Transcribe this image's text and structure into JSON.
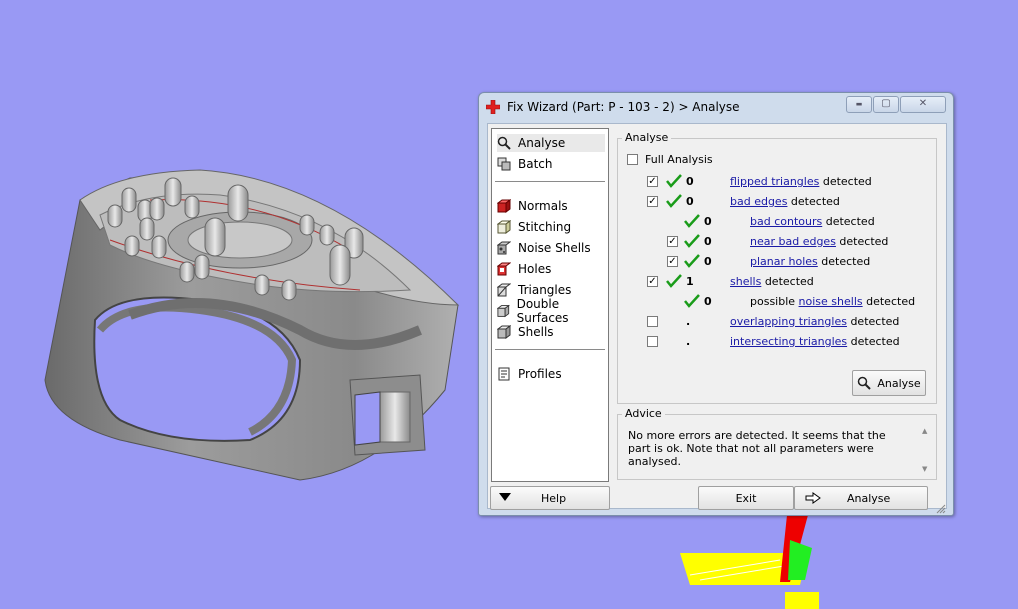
{
  "window": {
    "title": "Fix Wizard (Part: P - 103 - 2) > Analyse",
    "controls": {
      "minimize": "▬",
      "maximize": "▢",
      "close": "✕"
    }
  },
  "nav": {
    "top_items": [
      {
        "label": "Analyse",
        "icon": "magnifier-icon"
      },
      {
        "label": "Batch",
        "icon": "batch-icon"
      }
    ],
    "tool_items": [
      {
        "label": "Normals",
        "icon": "normals-icon"
      },
      {
        "label": "Stitching",
        "icon": "stitching-icon"
      },
      {
        "label": "Noise Shells",
        "icon": "noise-shells-icon"
      },
      {
        "label": "Holes",
        "icon": "holes-icon"
      },
      {
        "label": "Triangles",
        "icon": "triangles-icon"
      },
      {
        "label": "Double Surfaces",
        "icon": "double-surfaces-icon"
      },
      {
        "label": "Shells",
        "icon": "shells-icon"
      }
    ],
    "bottom_items": [
      {
        "label": "Profiles",
        "icon": "profiles-icon"
      }
    ]
  },
  "analyse": {
    "group_label": "Analyse",
    "full_analysis_label": "Full Analysis",
    "full_analysis_checked": false,
    "rows": [
      {
        "checked": true,
        "ok": true,
        "count": "0",
        "prefix": "",
        "link": "flipped triangles",
        "suffix": " detected"
      },
      {
        "checked": true,
        "ok": true,
        "count": "0",
        "prefix": "",
        "link": "bad edges",
        "suffix": " detected"
      },
      {
        "checked": null,
        "ok": true,
        "count": "0",
        "prefix": "",
        "link": "bad contours",
        "suffix": " detected"
      },
      {
        "checked": true,
        "ok": true,
        "count": "0",
        "prefix": "",
        "link": "near bad edges",
        "suffix": " detected"
      },
      {
        "checked": true,
        "ok": true,
        "count": "0",
        "prefix": "",
        "link": "planar holes",
        "suffix": " detected"
      },
      {
        "checked": true,
        "ok": true,
        "count": "1",
        "prefix": "",
        "link": "shells",
        "suffix": " detected"
      },
      {
        "checked": null,
        "ok": true,
        "count": "0",
        "prefix": "possible ",
        "link": "noise shells",
        "suffix": " detected"
      },
      {
        "checked": false,
        "ok": false,
        "count": ".",
        "prefix": "",
        "link": "overlapping triangles",
        "suffix": " detected"
      },
      {
        "checked": false,
        "ok": false,
        "count": ".",
        "prefix": "",
        "link": "intersecting triangles",
        "suffix": " detected"
      }
    ],
    "analyse_button": "Analyse"
  },
  "advice": {
    "group_label": "Advice",
    "text": "No more errors are detected. It seems that the part is ok. Note that not all parameters were analysed."
  },
  "footer": {
    "help": "Help",
    "exit": "Exit",
    "analyse": "Analyse"
  },
  "colors": {
    "viewport_bg": "#9999f4",
    "check_green": "#1a9c1a",
    "link_blue": "#1a1aa6"
  }
}
